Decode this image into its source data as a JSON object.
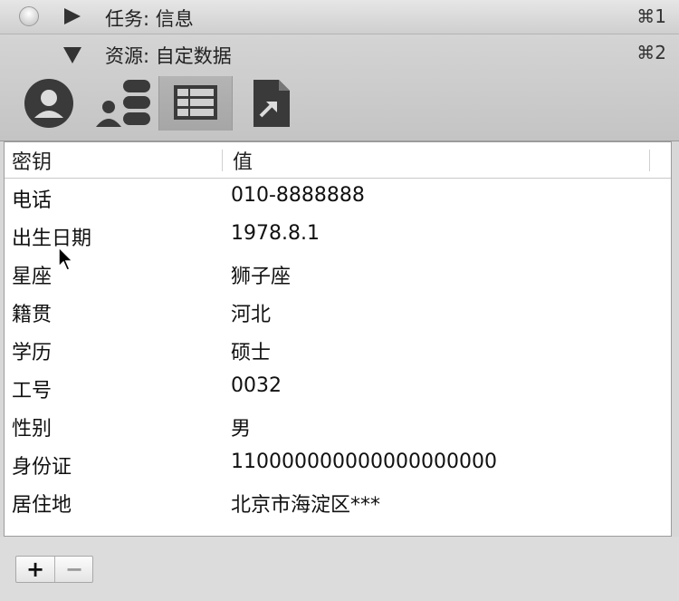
{
  "task_bar": {
    "title": "任务: 信息",
    "shortcut": "⌘1",
    "icons": {
      "collapse": "circle-button-icon",
      "disclosure": "triangle-right-icon"
    }
  },
  "resource_bar": {
    "title": "资源: 自定数据",
    "shortcut": "⌘2",
    "icons": {
      "disclosure": "triangle-down-icon"
    },
    "toolbar": [
      {
        "icon": "person-icon",
        "selected": false
      },
      {
        "icon": "group-icon",
        "selected": false
      },
      {
        "icon": "table-icon",
        "selected": true
      },
      {
        "icon": "document-link-icon",
        "selected": false
      }
    ]
  },
  "table": {
    "headers": {
      "key": "密钥",
      "value": "值"
    },
    "rows": [
      {
        "key": "电话",
        "value": "010-8888888"
      },
      {
        "key": "出生日期",
        "value": "1978.8.1"
      },
      {
        "key": "星座",
        "value": "狮子座"
      },
      {
        "key": "籍贯",
        "value": "河北"
      },
      {
        "key": "学历",
        "value": "硕士"
      },
      {
        "key": "工号",
        "value": "0032"
      },
      {
        "key": "性别",
        "value": "男"
      },
      {
        "key": "身份证",
        "value": "110000000000000000000"
      },
      {
        "key": "居住地",
        "value": "北京市海淀区***"
      }
    ]
  },
  "bottom": {
    "add_label": "+",
    "remove_label": "−"
  }
}
